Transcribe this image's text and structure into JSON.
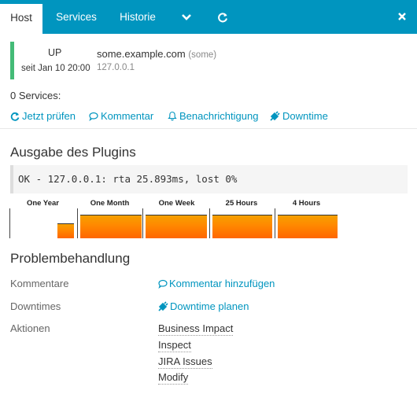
{
  "tabs": [
    {
      "label": "Host",
      "active": true
    },
    {
      "label": "Services",
      "active": false
    },
    {
      "label": "Historie",
      "active": false
    }
  ],
  "host": {
    "state": "UP",
    "since": "seit Jan 10 20:00",
    "name": "some.example.com",
    "alias": "(some)",
    "address": "127.0.0.1",
    "state_color": "#44bb77"
  },
  "services": {
    "summary": "0 Services:"
  },
  "quick_actions": {
    "check_now": "Jetzt prüfen",
    "comment": "Kommentar",
    "notification": "Benachrichtigung",
    "downtime": "Downtime"
  },
  "plugin": {
    "heading": "Ausgabe des Plugins",
    "output": "OK - 127.0.0.1: rta 25.893ms, lost 0%"
  },
  "graphs": [
    {
      "label": "One Year",
      "fill": 0.5
    },
    {
      "label": "One Month",
      "fill": 0.78
    },
    {
      "label": "One Week",
      "fill": 0.78
    },
    {
      "label": "25 Hours",
      "fill": 0.78
    },
    {
      "label": "4 Hours",
      "fill": 0.78
    }
  ],
  "problem_handling": {
    "heading": "Problembehandlung",
    "comments_label": "Kommentare",
    "add_comment": "Kommentar hinzufügen",
    "downtimes_label": "Downtimes",
    "schedule_downtime": "Downtime planen",
    "actions_label": "Aktionen",
    "actions": [
      "Business Impact",
      "Inspect",
      "JIRA Issues",
      "Modify"
    ]
  },
  "colors": {
    "accent": "#0095bf",
    "up": "#44bb77",
    "graph": "#ff8a00"
  },
  "icons": [
    "chevron-down-icon",
    "refresh-icon",
    "close-icon",
    "comment-icon",
    "bell-icon",
    "plug-icon"
  ]
}
